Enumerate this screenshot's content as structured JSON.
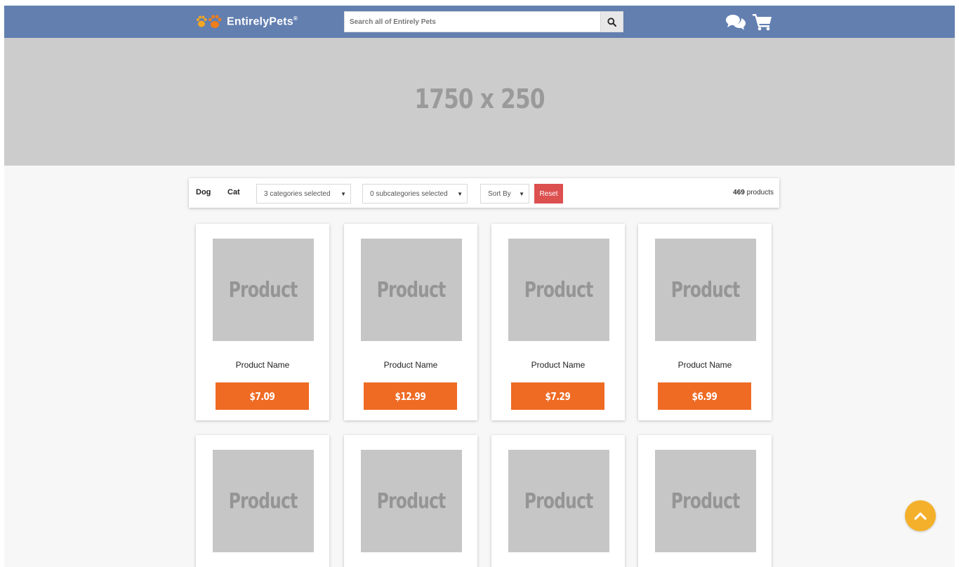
{
  "header": {
    "logo_text": "EntirelyPets",
    "logo_mark": "®",
    "search_placeholder": "Search all of Entirely Pets",
    "icons": [
      "paw-icon",
      "search-icon",
      "chat-icon",
      "cart-icon"
    ]
  },
  "banner": {
    "text": "1750 x 250"
  },
  "filters": {
    "pets": [
      "Dog",
      "Cat"
    ],
    "categories_select": "3 categories selected",
    "subcategories_select": "0 subcategories selected",
    "sort_select": "Sort By",
    "reset_label": "Reset",
    "count_number": "469",
    "count_label": "products"
  },
  "products": [
    {
      "image_label": "Product",
      "name": "Product Name",
      "price": "$7.09"
    },
    {
      "image_label": "Product",
      "name": "Product Name",
      "price": "$12.99"
    },
    {
      "image_label": "Product",
      "name": "Product Name",
      "price": "$7.29"
    },
    {
      "image_label": "Product",
      "name": "Product Name",
      "price": "$6.99"
    },
    {
      "image_label": "Product"
    },
    {
      "image_label": "Product"
    },
    {
      "image_label": "Product"
    },
    {
      "image_label": "Product"
    }
  ],
  "colors": {
    "header": "#627fb0",
    "price_button": "#ef6a23",
    "reset_button": "#dc5050",
    "scroll_top": "#f4b02a",
    "placeholder": "#cccccc"
  }
}
